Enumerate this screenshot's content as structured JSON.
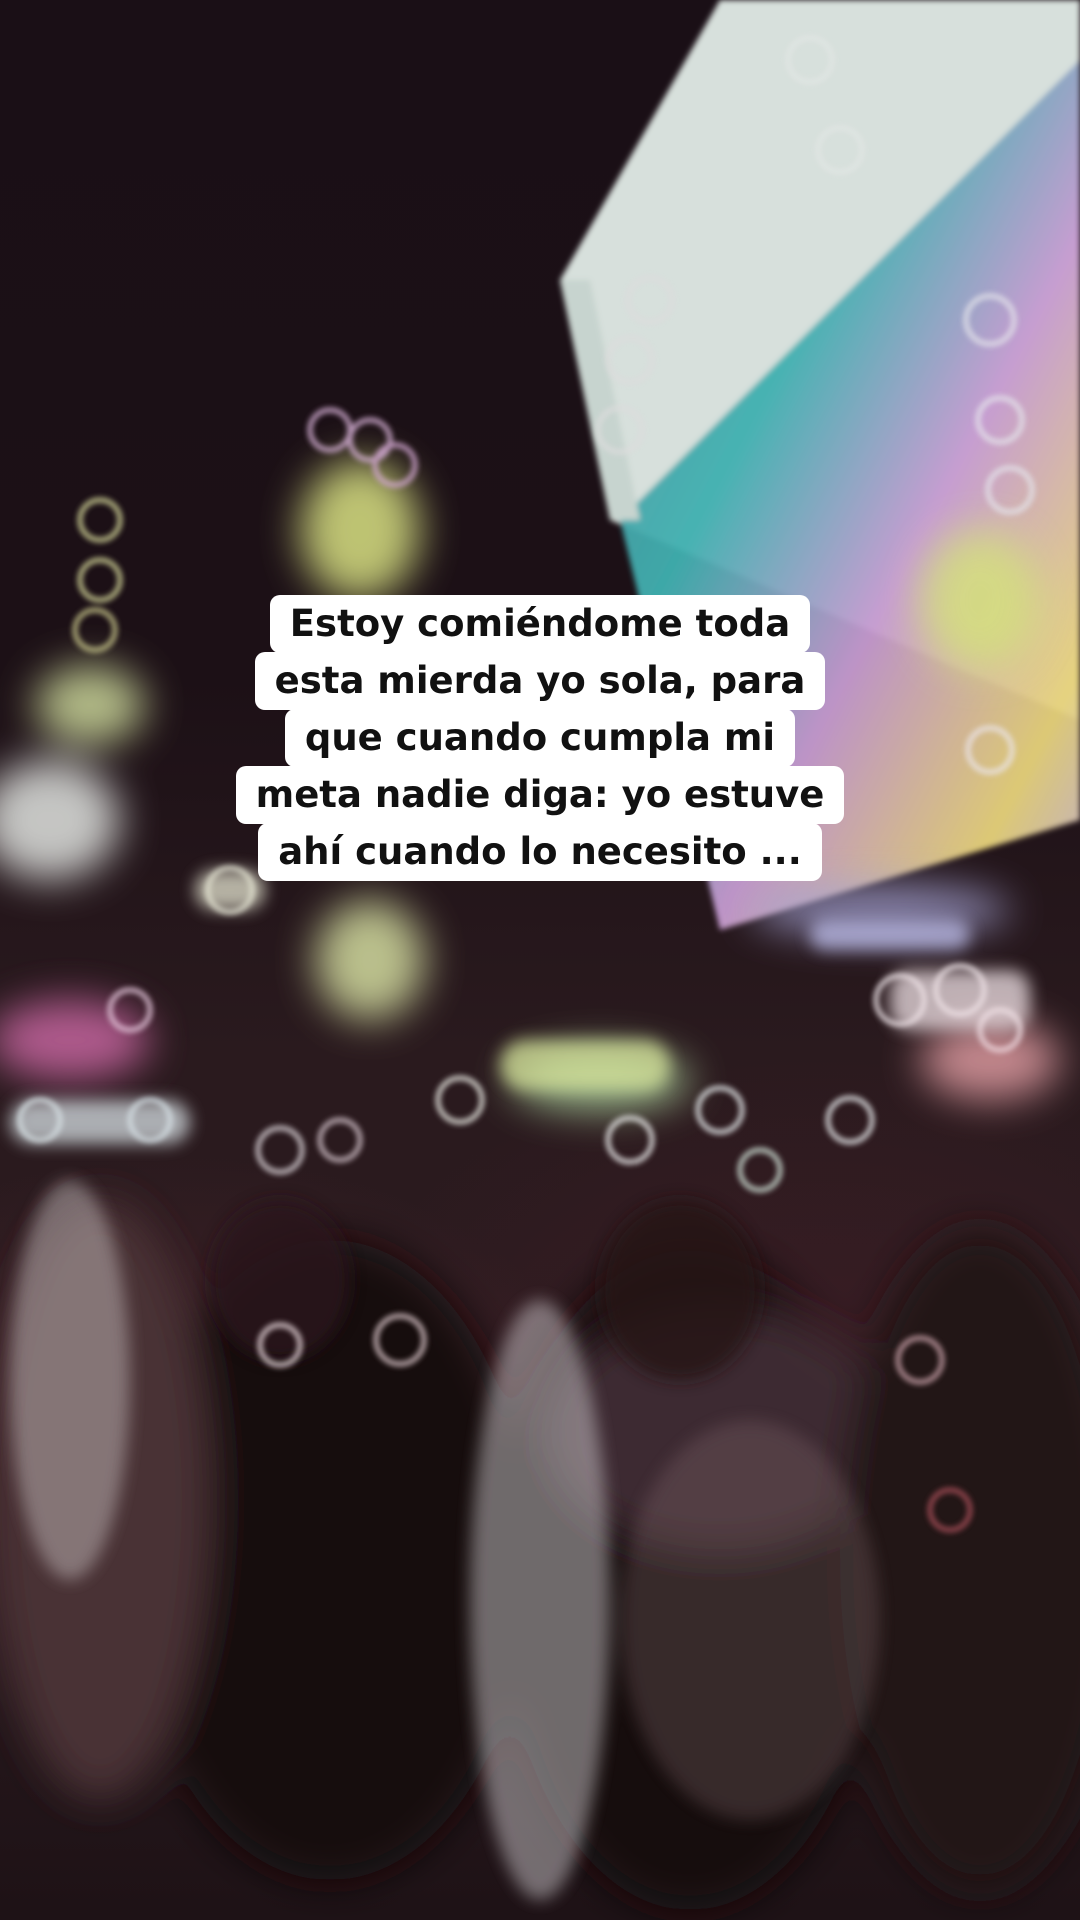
{
  "caption": {
    "lines": [
      "Estoy comiéndome toda",
      "esta mierda yo sola, para",
      "que cuando cumpla mi",
      "meta nadie diga: yo estuve",
      "ahí cuando lo necesito ..."
    ]
  },
  "scene": {
    "description_icons": [
      "bokeh-lights-background",
      "crowd-silhouettes",
      "signboard-panel"
    ],
    "colors": {
      "background_dark": "#1b0f14",
      "caption_bg": "#ffffff",
      "caption_text": "#111111"
    }
  }
}
